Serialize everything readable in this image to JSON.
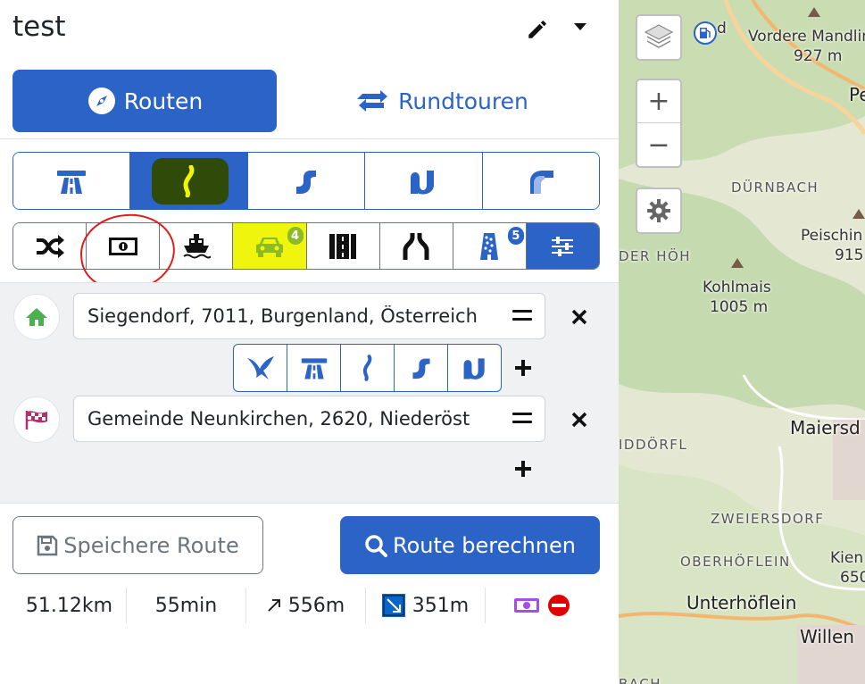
{
  "header": {
    "title": "test",
    "edit_icon": "pencil-icon",
    "menu_icon": "caret-down-icon"
  },
  "modes": [
    {
      "label": "Routen",
      "icon": "compass-icon",
      "active": true
    },
    {
      "label": "Rundtouren",
      "icon": "retweet-icon",
      "active": false
    }
  ],
  "route_types": [
    {
      "icon": "motorway-icon",
      "selected": false
    },
    {
      "icon": "curvy-road-icon",
      "selected": true
    },
    {
      "icon": "curve-icon",
      "selected": false
    },
    {
      "icon": "double-curve-icon",
      "selected": false
    },
    {
      "icon": "light-curve-icon",
      "selected": false
    }
  ],
  "options": [
    {
      "icon": "shuffle-icon"
    },
    {
      "icon": "toll-money-icon"
    },
    {
      "icon": "ferry-icon"
    },
    {
      "icon": "car-icon",
      "badge": "4"
    },
    {
      "icon": "tunnel-icon"
    },
    {
      "icon": "narrow-road-icon"
    },
    {
      "icon": "gravel-road-icon",
      "badge": "5"
    },
    {
      "icon": "sliders-icon"
    }
  ],
  "waypoints": {
    "start": {
      "value": "Siegendorf, 7011, Burgenland, Österreich",
      "icon": "home-icon"
    },
    "end": {
      "value": "Gemeinde Neunkirchen, 2620, Niederöst",
      "icon": "checkered-flag-icon"
    },
    "via_types": [
      "swallow-icon",
      "motorway-icon",
      "curvy-road-icon",
      "curve-icon",
      "double-curve-icon"
    ]
  },
  "actions": {
    "save": "Speichere Route",
    "calculate": "Route berechnen"
  },
  "stats": {
    "distance": "51.12km",
    "duration": "55min",
    "ascent": "556m",
    "descent": "351m",
    "ascent_icon": "arrow-up-right-icon",
    "descent_icon": "arrow-down-right-icon",
    "toll_icons": [
      "toll-money-icon",
      "no-entry-icon"
    ]
  },
  "map": {
    "labels": {
      "vordere": "Vordere Mandlin",
      "vordere_ele": "927 m",
      "pe": "Pe",
      "duernbach": "DÜRNBACH",
      "peisching": "Peischin",
      "peisching_ele": "915",
      "der_hoeh": "DER HÖH",
      "kohlmais": "Kohlmais",
      "kohlmais_ele": "1005 m",
      "maiersdorf": "Maiersd",
      "iddoerfl": "IDDÖRFL",
      "zweiersdorf": "ZWEIERSDORF",
      "oberhoeflein": "OBERHÖFLEIN",
      "kien": "Kien",
      "kien_ele": "650",
      "unterhoeflein": "Unterhöflein",
      "willend": "Willen",
      "bach": "BACH",
      "fuel": "d"
    },
    "controls": {
      "layers": "layers-icon",
      "zoom_in": "+",
      "zoom_out": "−",
      "settings": "gear-icon"
    }
  },
  "colors": {
    "primary": "#2c63c6",
    "home": "#4caf50",
    "flag": "#b0316b",
    "badge_green": "#8dbb25"
  }
}
